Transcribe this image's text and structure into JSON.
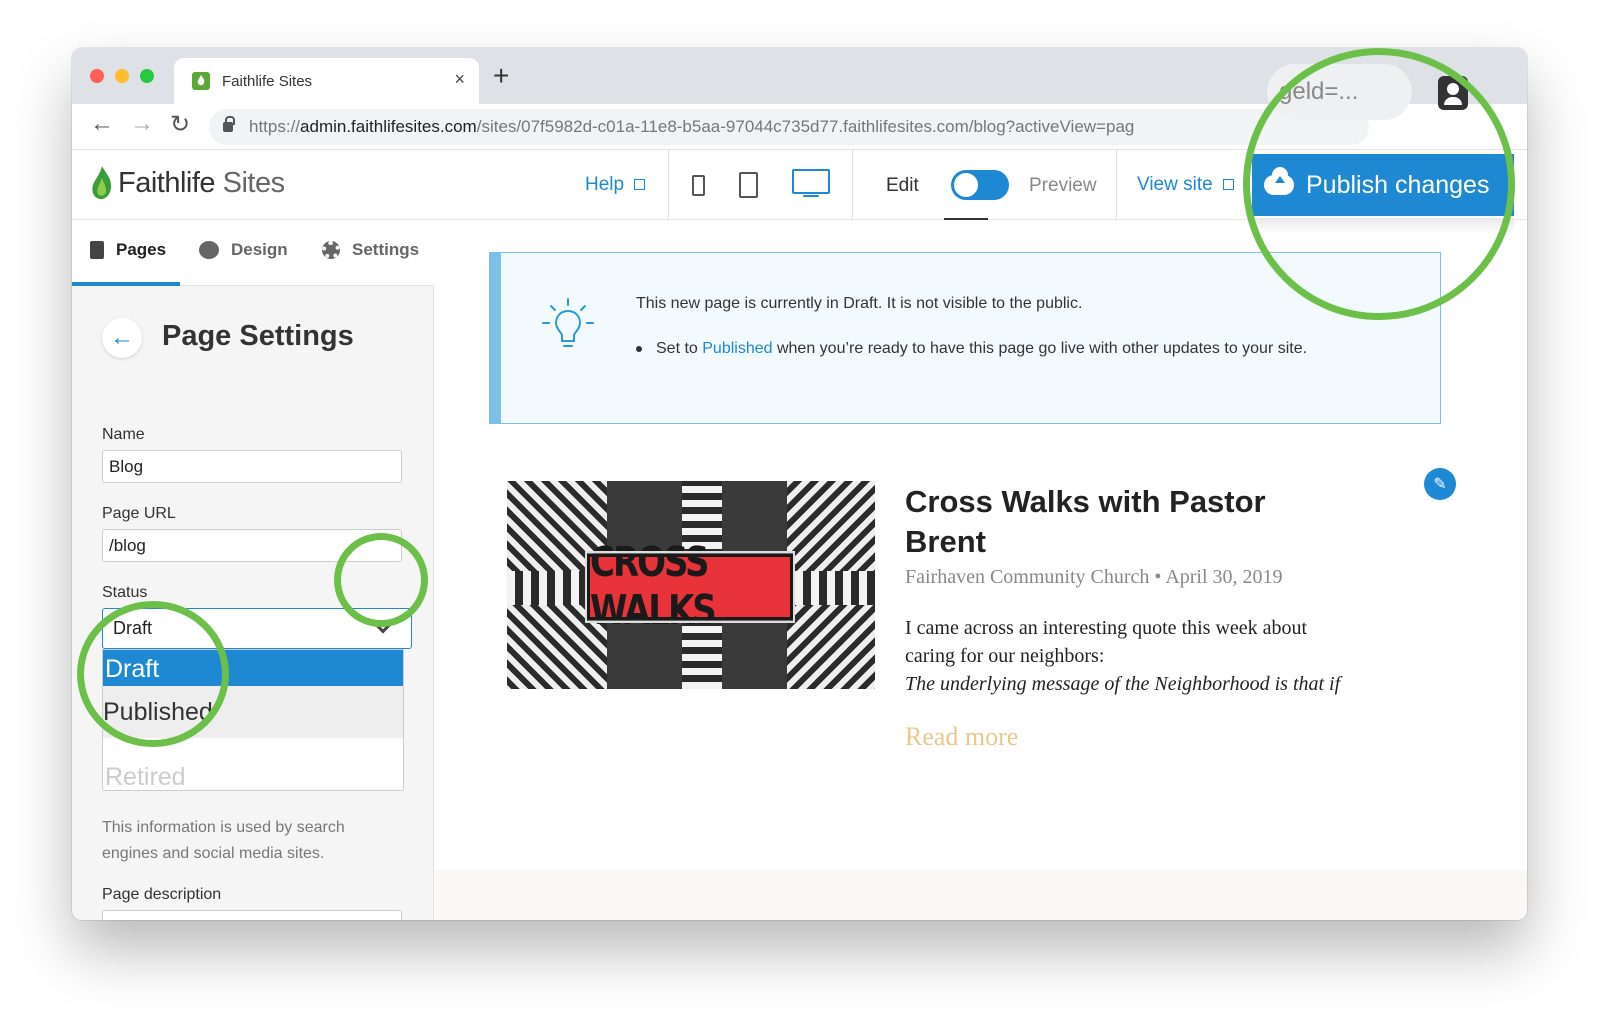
{
  "browser": {
    "tab_title": "Faithlife Sites",
    "tab_close": "×",
    "new_tab": "+",
    "nav": {
      "back": "←",
      "forward": "→",
      "reload": "↻"
    },
    "url_prefix": "https://",
    "url_domain": "admin.faithlifesites.com",
    "url_path": "/sites/07f5982d-c01a-11e8-b5aa-97044c735d77.faithlifesites.com/blog?activeView=pag",
    "url_overflow": "geld=..."
  },
  "app": {
    "logo_bold": "Faithlife",
    "logo_thin": " Sites",
    "help": "Help",
    "edit": "Edit",
    "preview": "Preview",
    "view_site": "View site",
    "publish": "Publish changes",
    "mode_toggle_on": true
  },
  "sidebar": {
    "tabs": [
      {
        "label": "Pages",
        "icon": "page-icon",
        "active": true
      },
      {
        "label": "Design",
        "icon": "palette-icon",
        "active": false
      },
      {
        "label": "Settings",
        "icon": "gear-icon",
        "active": false
      }
    ],
    "back": "←",
    "title": "Page Settings",
    "name_label": "Name",
    "name_value": "Blog",
    "url_label": "Page URL",
    "url_value": "/blog",
    "status_label": "Status",
    "status_value": "Draft",
    "status_options": [
      "Draft",
      "Published",
      "Retired"
    ],
    "hint": "This information is used by search engines and social media sites.",
    "description_label": "Page description"
  },
  "notice": {
    "line1": "This new page is currently in Draft. It is not visible to the public.",
    "line2_pre": "Set to ",
    "line2_link": "Published",
    "line2_post": " when you’re ready to have this page go live with other updates to your site."
  },
  "post": {
    "image_text": "CROSS WALKS",
    "title": "Cross Walks with Pastor Brent",
    "meta": "Fairhaven Community Church • April 30, 2019",
    "excerpt": "I came across an interesting quote this week about caring for our neighbors:",
    "excerpt_italic": "The underlying message of the Neighborhood is that if",
    "read_more": "Read more"
  },
  "colors": {
    "accent": "#1e88d2",
    "highlight_ring": "#6cc04a",
    "read_more": "#e7c98c",
    "brand_green": "#5ba836"
  }
}
